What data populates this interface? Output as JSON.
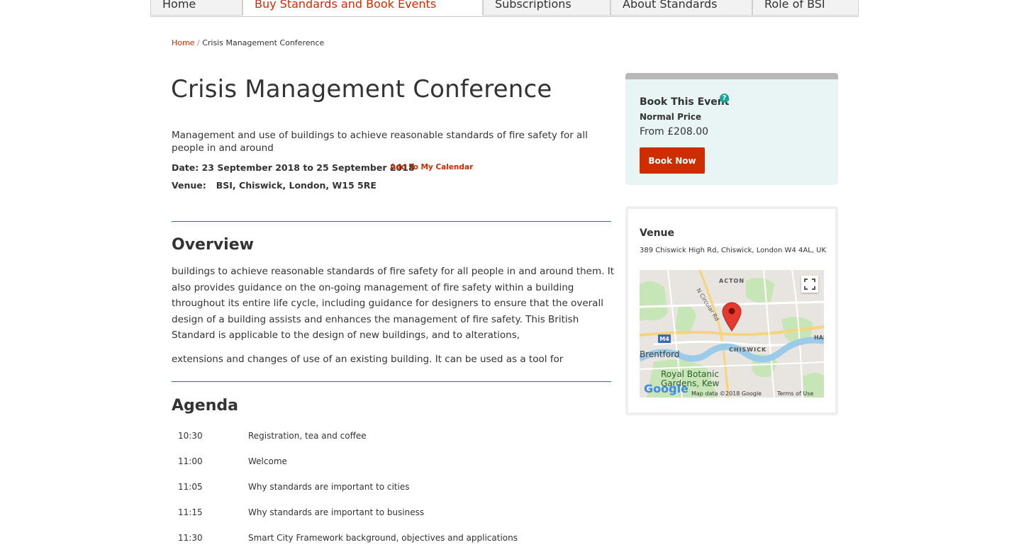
{
  "nav": {
    "tabs": [
      "Home",
      "Buy Standards and Book Events",
      "Subscriptions",
      "About Standards",
      "Role of BSI"
    ]
  },
  "breadcrumb": {
    "home": "Home",
    "separator": " / ",
    "current": "Crisis Management Conference"
  },
  "event": {
    "title": "Crisis Management Conference",
    "description": "Management and use of buildings to achieve reasonable standards of fire safety for all people in and around",
    "date": "Date: 23 September 2018 to 25 September 2018",
    "add_calendar": "Add To My Calendar",
    "venue_label": "Venue:",
    "venue": "BSI, Chiswick, London, W15 5RE"
  },
  "overview": {
    "heading": "Overview",
    "paragraph1": "buildings to achieve reasonable standards of fire safety for all people in and around them. It also provides guidance on the on-going management of fire safety within a building throughout its entire life cycle, including guidance for designers to ensure that the overall design of a building assists and enhances the management of fire safety. This British Standard is applicable to the design of new buildings, and to alterations,",
    "paragraph2": "extensions and changes of use of an existing building. It can be used as a tool for"
  },
  "agenda": {
    "heading": "Agenda",
    "items": [
      {
        "time": "10:30",
        "desc": "Registration, tea and coffee"
      },
      {
        "time": "11:00",
        "desc": "Welcome"
      },
      {
        "time": "11:05",
        "desc": "Why standards are important to cities"
      },
      {
        "time": "11:15",
        "desc": "Why standards are important to business"
      },
      {
        "time": "11:30",
        "desc": "Smart City Framework background, objectives and applications"
      }
    ]
  },
  "booking": {
    "title": "Book This Event",
    "help_icon": "?",
    "price_label": "Normal Price",
    "price": "From £208.00",
    "button": "Book Now"
  },
  "venue_panel": {
    "title": "Venue",
    "address": "389 Chiswick High Rd, Chiswick, London W4 4AL, UK",
    "map": {
      "labels": [
        "ACTON",
        "N Circular Rd",
        "M4",
        "Brentford",
        "CHISWICK",
        "HAM",
        "Royal Botanic",
        "Gardens, Kew"
      ],
      "logo": "Google",
      "attribution": "Map data ©2018 Google",
      "terms": "Terms of Use"
    }
  },
  "colors": {
    "accent": "#cc2e00",
    "teal": "#1f7d7a",
    "book_bg": "#e8f5f4"
  }
}
